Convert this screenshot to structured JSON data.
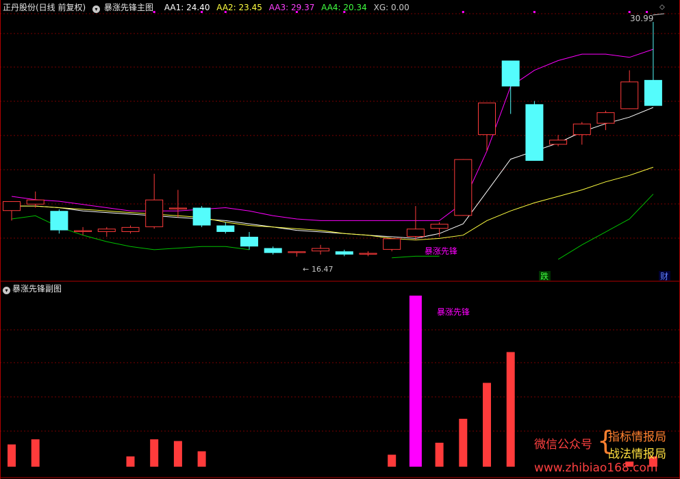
{
  "header": {
    "stock_name": "正丹股份(日线 前复权)",
    "indicator_name": "暴涨先锋主图",
    "aa1": "AA1: 24.40",
    "aa2": "AA2: 23.45",
    "aa3": "AA3: 29.37",
    "aa4": "AA4: 20.34",
    "xg": "XG: 0.00"
  },
  "sub_header": {
    "indicator_name": "暴涨先锋副图"
  },
  "labels": {
    "high_price": "30.99",
    "low_price": "16.47",
    "main_signal": "暴涨先锋",
    "sub_signal": "暴涨先锋",
    "drop_marker": "跌",
    "fin_marker": "财"
  },
  "watermark": {
    "wechat": "微信公众号",
    "brace": "{",
    "line1": "指标情报局",
    "line2": "战法情报局",
    "url": "www.zhibiao168.com"
  },
  "colors": {
    "up": "#ff3b3b",
    "down": "#54fcfc",
    "magenta": "#ff00ff",
    "white_line": "#ffffff",
    "yellow_line": "#ffff40",
    "green_line": "#00c000",
    "grid": "#7a0000"
  },
  "chart_data": [
    {
      "type": "candlestick",
      "title": "暴涨先锋主图",
      "ylim": [
        15.5,
        31.5
      ],
      "candles": [
        {
          "open": 19.3,
          "high": 19.7,
          "low": 18.7,
          "close": 19.9
        },
        {
          "open": 19.7,
          "high": 20.5,
          "low": 19.5,
          "close": 20.0
        },
        {
          "open": 19.3,
          "high": 19.4,
          "low": 17.9,
          "close": 18.1
        },
        {
          "open": 18.0,
          "high": 18.3,
          "low": 17.8,
          "close": 18.1
        },
        {
          "open": 18.0,
          "high": 18.3,
          "low": 17.7,
          "close": 18.2
        },
        {
          "open": 18.0,
          "high": 18.4,
          "low": 17.9,
          "close": 18.3
        },
        {
          "open": 18.3,
          "high": 21.6,
          "low": 18.2,
          "close": 20.0
        },
        {
          "open": 19.4,
          "high": 20.6,
          "low": 18.9,
          "close": 19.5
        },
        {
          "open": 19.5,
          "high": 19.6,
          "low": 18.3,
          "close": 18.4
        },
        {
          "open": 18.4,
          "high": 18.6,
          "low": 17.9,
          "close": 18.0
        },
        {
          "open": 17.7,
          "high": 18.0,
          "low": 16.9,
          "close": 17.1
        },
        {
          "open": 17.0,
          "high": 17.1,
          "low": 16.6,
          "close": 16.7
        },
        {
          "open": 16.7,
          "high": 16.8,
          "low": 16.47,
          "close": 16.8
        },
        {
          "open": 16.8,
          "high": 17.2,
          "low": 16.6,
          "close": 17.0
        },
        {
          "open": 16.8,
          "high": 16.9,
          "low": 16.5,
          "close": 16.6
        },
        {
          "open": 16.6,
          "high": 16.8,
          "low": 16.5,
          "close": 16.7
        },
        {
          "open": 16.9,
          "high": 17.6,
          "low": 16.8,
          "close": 17.6
        },
        {
          "open": 17.7,
          "high": 19.6,
          "low": 17.5,
          "close": 18.2
        },
        {
          "open": 18.2,
          "high": 18.6,
          "low": 17.7,
          "close": 18.5
        },
        {
          "open": 19.0,
          "high": 22.5,
          "low": 19.0,
          "close": 22.5
        },
        {
          "open": 24.0,
          "high": 26.0,
          "low": 23.0,
          "close": 26.0
        },
        {
          "open": 28.6,
          "high": 28.6,
          "low": 25.3,
          "close": 27.0
        },
        {
          "open": 25.9,
          "high": 26.1,
          "low": 22.4,
          "close": 22.4
        },
        {
          "open": 23.4,
          "high": 24.0,
          "low": 23.3,
          "close": 23.7
        },
        {
          "open": 24.0,
          "high": 24.8,
          "low": 23.4,
          "close": 24.7
        },
        {
          "open": 24.7,
          "high": 25.5,
          "low": 24.3,
          "close": 25.4
        },
        {
          "open": 25.6,
          "high": 28.0,
          "low": 25.6,
          "close": 27.3
        },
        {
          "open": 27.4,
          "high": 30.99,
          "low": 27.4,
          "close": 25.8
        }
      ],
      "lines": {
        "white": [
          19.6,
          19.6,
          19.5,
          19.3,
          19.2,
          19.1,
          19.0,
          18.9,
          18.8,
          18.7,
          18.5,
          18.3,
          18.1,
          18.0,
          17.9,
          17.8,
          17.7,
          17.6,
          17.9,
          18.5,
          20.5,
          22.5,
          23.0,
          23.5,
          24.2,
          24.7,
          25.1,
          25.7
        ],
        "yellow": [
          19.6,
          19.6,
          19.5,
          19.4,
          19.3,
          19.2,
          19.1,
          19.0,
          18.9,
          18.6,
          18.4,
          18.3,
          18.2,
          18.1,
          17.9,
          17.8,
          17.6,
          17.5,
          17.6,
          17.8,
          18.7,
          19.3,
          19.8,
          20.2,
          20.6,
          21.1,
          21.5,
          22.0
        ],
        "magenta": [
          20.2,
          20.0,
          19.9,
          19.7,
          19.5,
          19.3,
          19.3,
          19.3,
          19.4,
          19.5,
          19.3,
          19.0,
          18.8,
          18.7,
          18.7,
          18.7,
          18.7,
          18.7,
          18.7,
          19.8,
          23.0,
          27.0,
          28.0,
          28.6,
          29.0,
          29.0,
          28.8,
          29.3
        ],
        "green": [
          18.8,
          19.0,
          18.3,
          17.8,
          17.4,
          17.1,
          16.9,
          17.0,
          17.1,
          17.1,
          16.9,
          null,
          null,
          null,
          null,
          null,
          16.4,
          16.5,
          16.5,
          null,
          null,
          null,
          null,
          16.3,
          17.2,
          18.0,
          18.8,
          20.34
        ]
      },
      "top_markers_index": [
        6,
        8,
        9,
        12,
        14,
        19,
        22,
        26
      ]
    },
    {
      "type": "bar",
      "title": "暴涨先锋副图",
      "ylim": [
        0,
        100
      ],
      "values": [
        13,
        16,
        null,
        null,
        null,
        6,
        16,
        15,
        9,
        null,
        null,
        null,
        null,
        null,
        null,
        null,
        7,
        100,
        14,
        28,
        49,
        67,
        null,
        null,
        null,
        null,
        3,
        6
      ],
      "highlight_index": 17
    }
  ]
}
